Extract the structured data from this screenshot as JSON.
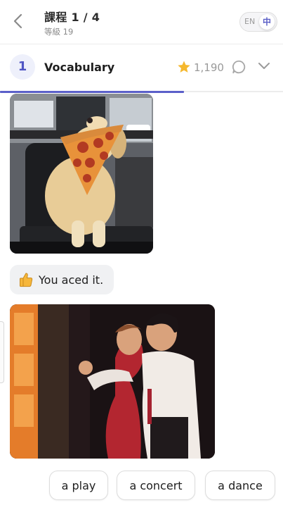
{
  "header": {
    "title": "課程 1 / 4",
    "subtitle": "等級 19",
    "lang_toggle": {
      "en_label": "EN",
      "zh_label": "中",
      "selected": "中"
    }
  },
  "lesson": {
    "number": "1",
    "title": "Vocabulary",
    "points": "1,190",
    "progress": 0.65
  },
  "messages": {
    "image1": {
      "icon": "dog-with-pizza-slice-image"
    },
    "feedback": {
      "emoji_icon": "thumbs-up-icon",
      "text": "You aced it."
    },
    "image2": {
      "icon": "couple-dancing-tango-image"
    }
  },
  "answer_options": [
    "a play",
    "a concert",
    "a dance"
  ],
  "colors": {
    "accent": "#5b60c9",
    "star": "#f5b82e",
    "bubble": "#f0f1f3"
  }
}
